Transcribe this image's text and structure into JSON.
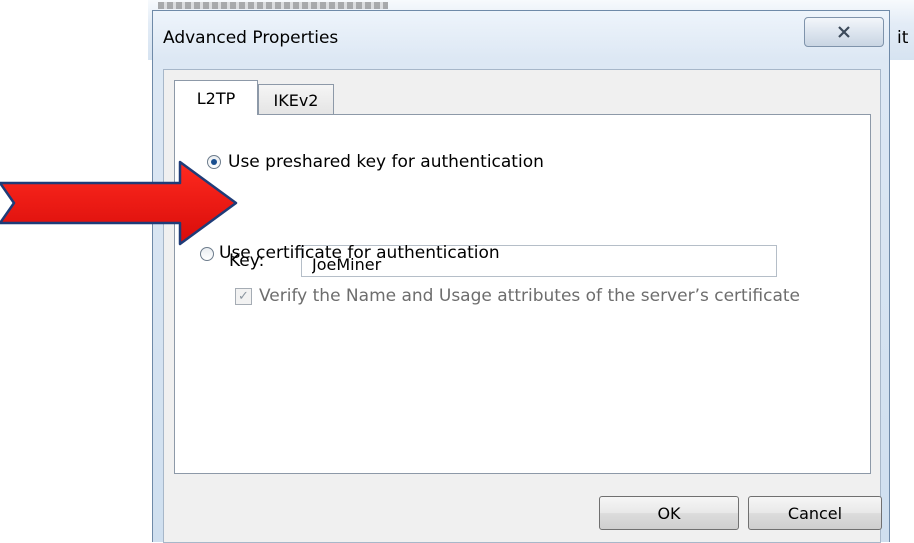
{
  "dialog": {
    "title": "Advanced Properties",
    "close_icon": "close-icon"
  },
  "background": {
    "side_text": "it"
  },
  "tabs": [
    {
      "label": "L2TP",
      "active": true
    },
    {
      "label": "IKEv2",
      "active": false
    }
  ],
  "l2tp": {
    "preshared_radio_label": "Use preshared key for authentication",
    "preshared_selected": true,
    "key_label": "Key:",
    "key_value": "JoeMiner",
    "certificate_radio_label": "Use certificate for authentication",
    "certificate_selected": false,
    "verify_checkbox_label": "Verify the Name and Usage attributes of the server’s certificate",
    "verify_checked": true,
    "verify_disabled": true
  },
  "buttons": {
    "ok": "OK",
    "cancel": "Cancel"
  },
  "annotation": {
    "arrow_icon": "red-arrow-icon",
    "arrow_color": "#e8120f"
  }
}
